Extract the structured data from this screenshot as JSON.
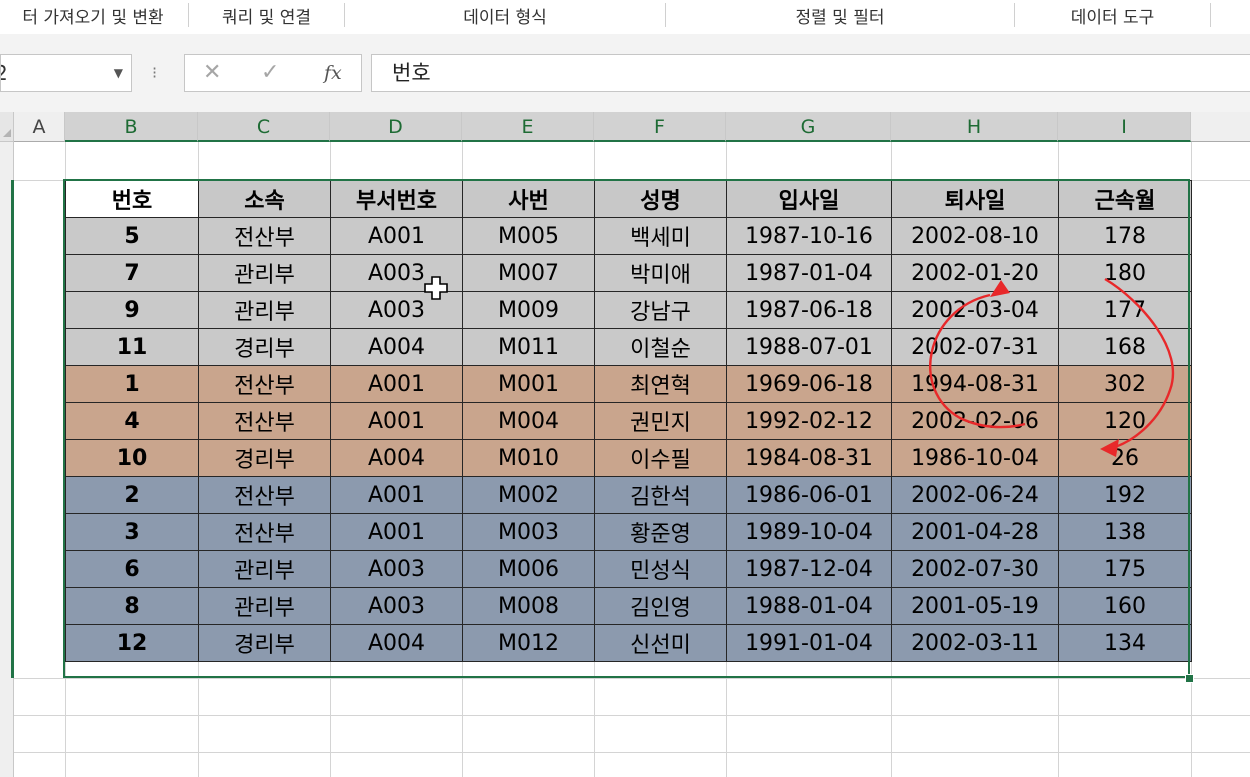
{
  "ribbon": {
    "groups": [
      {
        "label": "터 가져오기 및 변환"
      },
      {
        "label": "쿼리 및 연결"
      },
      {
        "label": "데이터 형식"
      },
      {
        "label": "정렬 및 필터"
      },
      {
        "label": "데이터 도구"
      }
    ]
  },
  "formula_bar": {
    "name_box_value": "2",
    "cancel_symbol": "✕",
    "enter_symbol": "✓",
    "fx_label": "fx",
    "content": "번호"
  },
  "columns": [
    "A",
    "B",
    "C",
    "D",
    "E",
    "F",
    "G",
    "H",
    "I"
  ],
  "selected_columns": [
    "B",
    "C",
    "D",
    "E",
    "F",
    "G",
    "H",
    "I"
  ],
  "table": {
    "headers": [
      "번호",
      "소속",
      "부서번호",
      "사번",
      "성명",
      "입사일",
      "퇴사일",
      "근속월"
    ],
    "groups": [
      {
        "color": "#c9c9c9",
        "rows": [
          [
            "5",
            "전산부",
            "A001",
            "M005",
            "백세미",
            "1987-10-16",
            "2002-08-10",
            "178"
          ],
          [
            "7",
            "관리부",
            "A003",
            "M007",
            "박미애",
            "1987-01-04",
            "2002-01-20",
            "180"
          ],
          [
            "9",
            "관리부",
            "A003",
            "M009",
            "강남구",
            "1987-06-18",
            "2002-03-04",
            "177"
          ],
          [
            "11",
            "경리부",
            "A004",
            "M011",
            "이철순",
            "1988-07-01",
            "2002-07-31",
            "168"
          ]
        ]
      },
      {
        "color": "#c9a58d",
        "rows": [
          [
            "1",
            "전산부",
            "A001",
            "M001",
            "최연혁",
            "1969-06-18",
            "1994-08-31",
            "302"
          ],
          [
            "4",
            "전산부",
            "A001",
            "M004",
            "권민지",
            "1992-02-12",
            "2002-02-06",
            "120"
          ],
          [
            "10",
            "경리부",
            "A004",
            "M010",
            "이수필",
            "1984-08-31",
            "1986-10-04",
            "26"
          ]
        ]
      },
      {
        "color": "#8c9aae",
        "rows": [
          [
            "2",
            "전산부",
            "A001",
            "M002",
            "김한석",
            "1986-06-01",
            "2002-06-24",
            "192"
          ],
          [
            "3",
            "전산부",
            "A001",
            "M003",
            "황준영",
            "1989-10-04",
            "2001-04-28",
            "138"
          ],
          [
            "6",
            "관리부",
            "A003",
            "M006",
            "민성식",
            "1987-12-04",
            "2002-07-30",
            "175"
          ],
          [
            "8",
            "관리부",
            "A003",
            "M008",
            "김인영",
            "1988-01-04",
            "2001-05-19",
            "160"
          ],
          [
            "12",
            "경리부",
            "A004",
            "M012",
            "신선미",
            "1991-01-04",
            "2002-03-11",
            "134"
          ]
        ]
      }
    ]
  },
  "colors": {
    "selection": "#217346",
    "arrow": "#e8282a",
    "header_fill": "#c8c8c8"
  }
}
